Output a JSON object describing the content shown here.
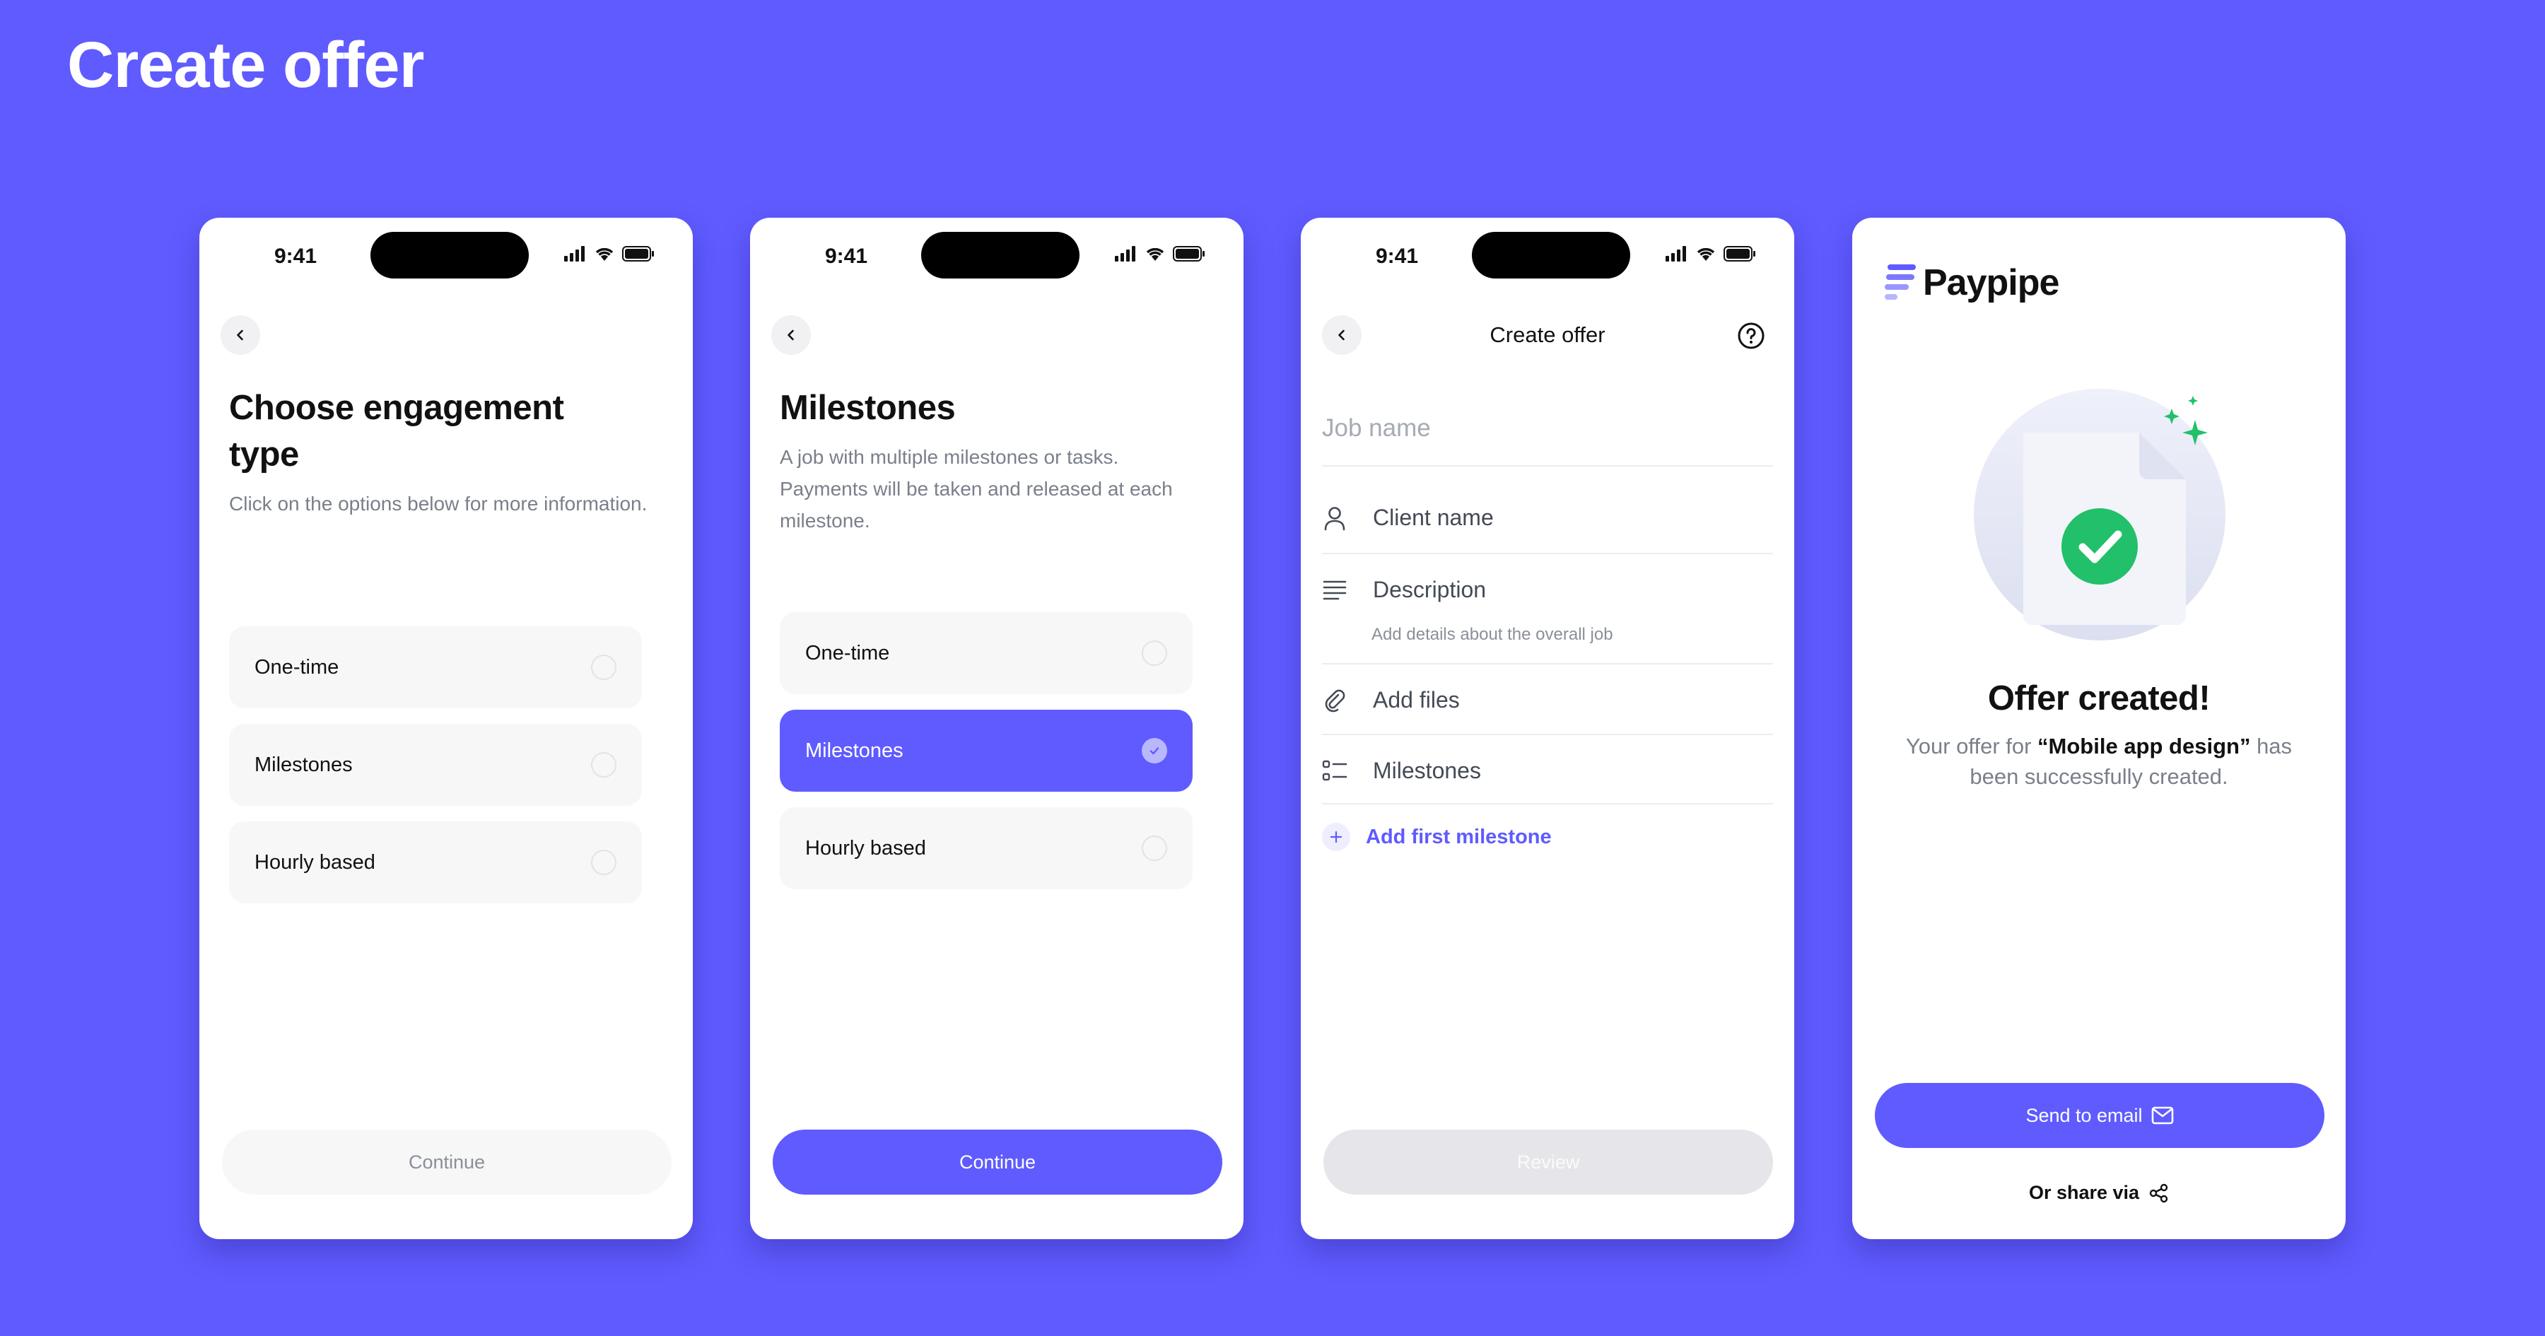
{
  "page": {
    "title": "Create offer"
  },
  "status_bar": {
    "time": "9:41"
  },
  "screen1": {
    "title": "Choose engagement type",
    "subtitle": "Click on the options below for more information.",
    "options": [
      "One-time",
      "Milestones",
      "Hourly based"
    ],
    "continue_label": "Continue"
  },
  "screen2": {
    "title": "Milestones",
    "subtitle": "A job with multiple milestones or tasks. Payments will be taken and released at each milestone.",
    "options": [
      "One-time",
      "Milestones",
      "Hourly based"
    ],
    "selected_option": "Milestones",
    "continue_label": "Continue"
  },
  "screen3": {
    "title": "Create offer",
    "job_name_placeholder": "Job name",
    "fields": {
      "client": "Client name",
      "description": "Description",
      "description_hint": "Add details about the overall job",
      "files": "Add files",
      "milestones": "Milestones"
    },
    "add_milestone_label": "Add first milestone",
    "review_label": "Review"
  },
  "screen4": {
    "brand": "Paypipe",
    "heading": "Offer created!",
    "message_prefix": "Your offer for ",
    "offer_name": "“Mobile app design”",
    "message_suffix": " has been successfully created.",
    "send_email_label": "Send to email",
    "share_label": "Or share via"
  },
  "colors": {
    "accent": "#5f5bff",
    "success": "#22c06a",
    "background": "#5f5bff"
  }
}
